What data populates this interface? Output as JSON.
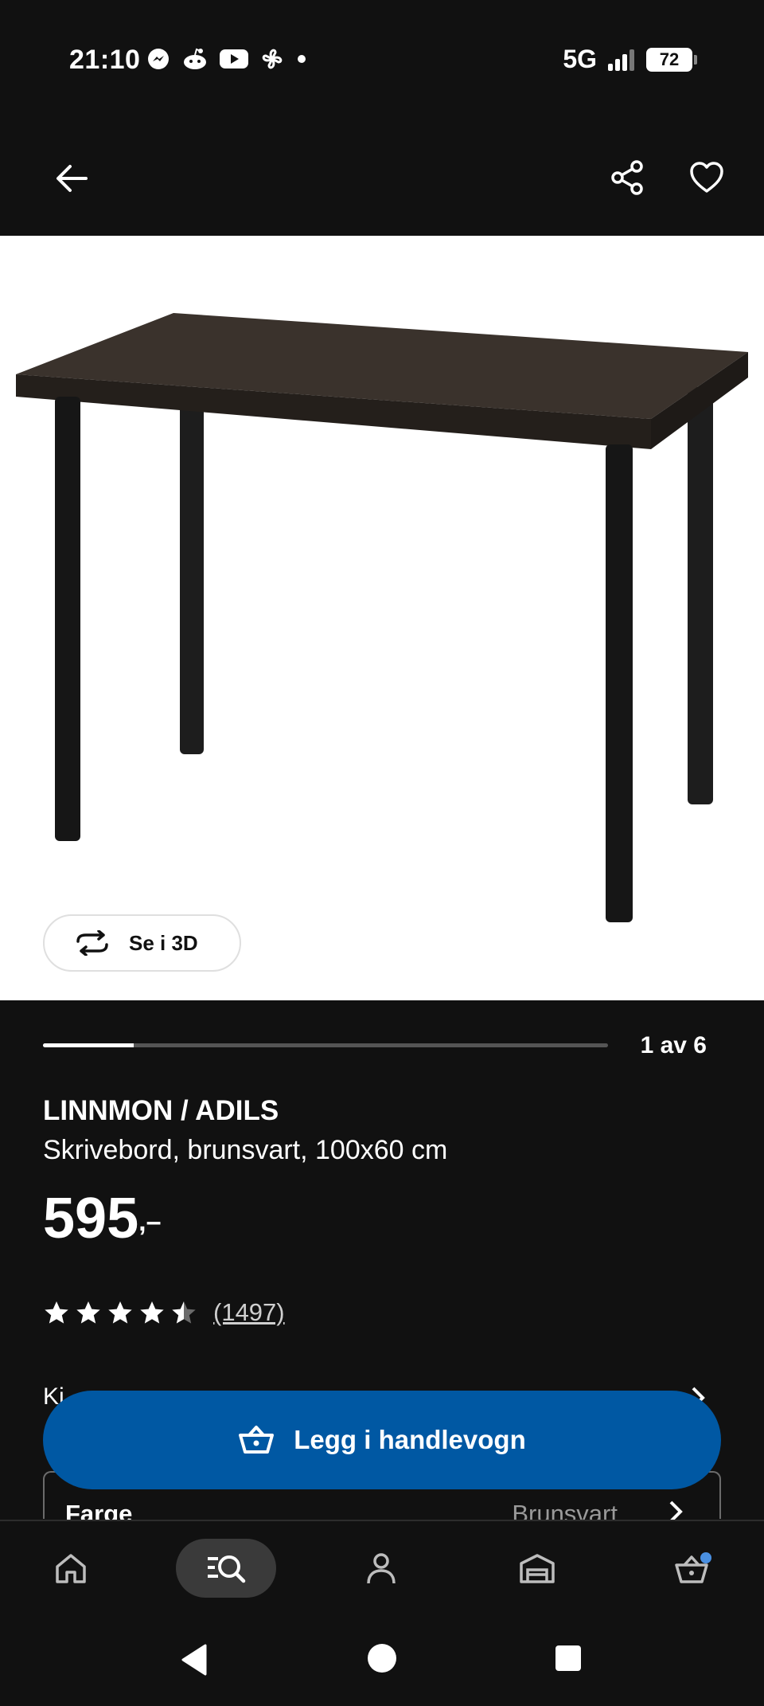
{
  "status_bar": {
    "time": "21:10",
    "notification_icons": [
      "messenger-icon",
      "reddit-icon",
      "youtube-icon",
      "fan-icon",
      "dot-icon"
    ],
    "network": "5G",
    "battery": "72"
  },
  "top_bar": {
    "icons": [
      "back-arrow-icon",
      "share-icon",
      "heart-icon"
    ]
  },
  "hero": {
    "view_3d_label": "Se i 3D"
  },
  "gallery": {
    "counter": "1 av 6",
    "progress": 0.16
  },
  "product": {
    "name": "LINNMON / ADILS",
    "description": "Skrivebord, brunsvart, 100x60 cm",
    "price": "595",
    "price_suffix": ",–",
    "rating": 4.5,
    "review_count": "(1497)"
  },
  "partial_row": {
    "label": "Ki"
  },
  "color_option": {
    "label": "Farge",
    "value": "Brunsvart"
  },
  "cart": {
    "label": "Legg i handlevogn"
  },
  "bottom_nav": {
    "items": [
      "home-icon",
      "search-browse-icon",
      "profile-icon",
      "store-icon",
      "basket-icon"
    ],
    "active_index": 1,
    "accent": "#0058a3"
  },
  "colors": {
    "background": "#111111",
    "primary_button": "#0058a3"
  }
}
